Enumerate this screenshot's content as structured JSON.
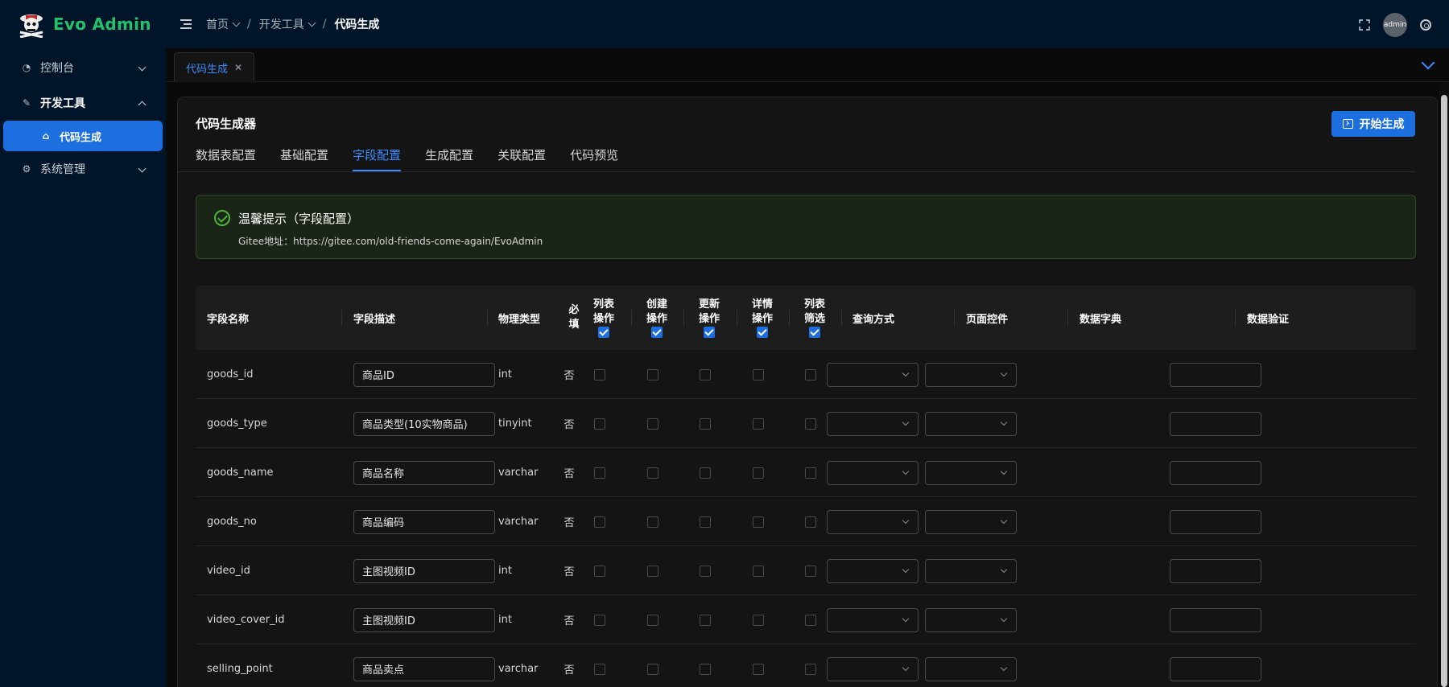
{
  "app": {
    "title": "Evo Admin"
  },
  "header": {
    "breadcrumb": [
      "首页",
      "开发工具",
      "代码生成"
    ],
    "avatar_text": "admin"
  },
  "sidebar": {
    "items": [
      {
        "label": "控制台",
        "icon": "dashboard-icon",
        "expanded": false
      },
      {
        "label": "开发工具",
        "icon": "tool-icon",
        "expanded": true
      },
      {
        "label": "代码生成",
        "icon": "code-icon",
        "active": true
      },
      {
        "label": "系统管理",
        "icon": "gear-icon",
        "expanded": false
      }
    ]
  },
  "page_tabs": [
    {
      "label": "代码生成",
      "closable": true
    }
  ],
  "card": {
    "title": "代码生成器",
    "generate_button": "开始生成",
    "tabs": [
      "数据表配置",
      "基础配置",
      "字段配置",
      "生成配置",
      "关联配置",
      "代码预览"
    ],
    "active_tab": "字段配置"
  },
  "alert": {
    "title": "温馨提示（字段配置）",
    "desc": "Gitee地址：https://gitee.com/old-friends-come-again/EvoAdmin"
  },
  "table": {
    "headers": {
      "name": "字段名称",
      "desc": "字段描述",
      "type": "物理类型",
      "required": [
        "必",
        "填"
      ],
      "list_op": [
        "列表",
        "操作"
      ],
      "create_op": [
        "创建",
        "操作"
      ],
      "update_op": [
        "更新",
        "操作"
      ],
      "detail_op": [
        "详情",
        "操作"
      ],
      "list_filter": [
        "列表",
        "筛选"
      ],
      "query": "查询方式",
      "control": "页面控件",
      "dict": "数据字典",
      "validate": "数据验证"
    },
    "rows": [
      {
        "name": "goods_id",
        "desc": "商品ID",
        "type": "int",
        "required": "否"
      },
      {
        "name": "goods_type",
        "desc": "商品类型(10实物商品)",
        "type": "tinyint",
        "required": "否"
      },
      {
        "name": "goods_name",
        "desc": "商品名称",
        "type": "varchar",
        "required": "否"
      },
      {
        "name": "goods_no",
        "desc": "商品编码",
        "type": "varchar",
        "required": "否"
      },
      {
        "name": "video_id",
        "desc": "主图视频ID",
        "type": "int",
        "required": "否"
      },
      {
        "name": "video_cover_id",
        "desc": "主图视频ID",
        "type": "int",
        "required": "否"
      },
      {
        "name": "selling_point",
        "desc": "商品卖点",
        "type": "varchar",
        "required": "否"
      }
    ]
  },
  "colors": {
    "accent": "#1d6fe0",
    "sidebar_bg": "#001529",
    "logo_green": "#21c26b",
    "success": "#4fb53a"
  }
}
